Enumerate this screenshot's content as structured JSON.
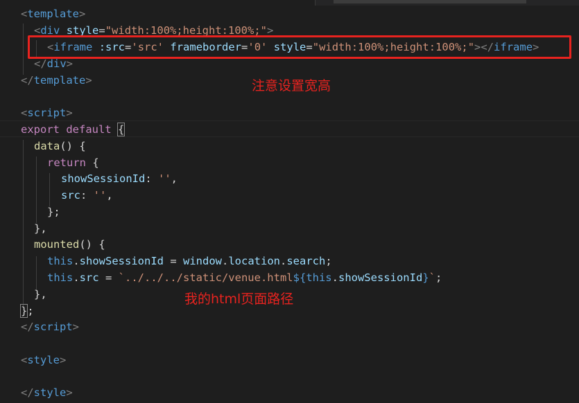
{
  "code": {
    "l1_tag": "template",
    "l2_tag": "div",
    "l2_attr": "style",
    "l2_val": "\"width:100%;height:100%;\"",
    "l3_tag": "iframe",
    "l3_attr1": ":src",
    "l3_val1": "'src'",
    "l3_attr2": "frameborder",
    "l3_val2": "'0'",
    "l3_attr3": "style",
    "l3_val3": "\"width:100%;height:100%;\"",
    "l3_close": "iframe",
    "l4_tag": "div",
    "l5_tag": "template",
    "l7_tag": "script",
    "l8_export": "export",
    "l8_default": "default",
    "l9_fn": "data",
    "l10_return": "return",
    "l11_key": "showSessionId",
    "l11_val": "''",
    "l12_key": "src",
    "l12_val": "''",
    "l15_fn": "mounted",
    "l16_this": "this",
    "l16_prop": "showSessionId",
    "l16_rhs1": "window",
    "l16_rhs2": "location",
    "l16_rhs3": "search",
    "l17_this": "this",
    "l17_prop": "src",
    "l17_tpl_str": "`../../../static/venue.html",
    "l17_this2": "this",
    "l17_prop2": "showSessionId",
    "l17_tpl_end": "`",
    "l20_tag": "script",
    "l22_tag": "style",
    "l24_tag": "style"
  },
  "annotations": {
    "note_size": "注意设置宽高",
    "note_path": "我的html页面路径"
  },
  "colors": {
    "background": "#1e1e1e",
    "annotation_red": "#e8231f",
    "tag_blue": "#569cd6",
    "attr_lightblue": "#9cdcfe",
    "string_orange": "#ce9178",
    "keyword_purple": "#c586c0",
    "function_yellow": "#dcdcaa"
  }
}
